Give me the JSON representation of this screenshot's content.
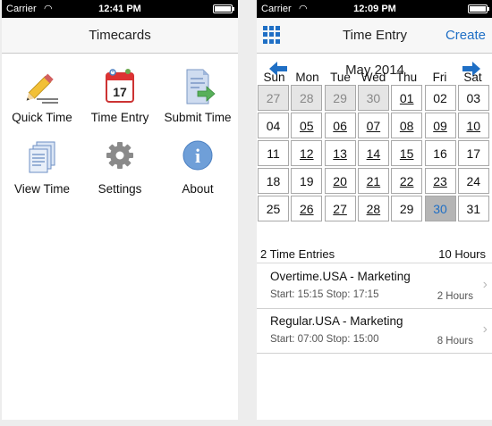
{
  "left": {
    "status": {
      "carrier": "Carrier",
      "time": "12:41 PM"
    },
    "title": "Timecards",
    "tiles": [
      {
        "label": "Quick Time",
        "icon": "pencil-icon"
      },
      {
        "label": "Time Entry",
        "icon": "calendar-icon",
        "badge": "17"
      },
      {
        "label": "Submit Time",
        "icon": "submit-document-icon"
      },
      {
        "label": "View Time",
        "icon": "document-stack-icon"
      },
      {
        "label": "Settings",
        "icon": "gear-icon"
      },
      {
        "label": "About",
        "icon": "info-icon",
        "glyph": "i"
      }
    ]
  },
  "right": {
    "status": {
      "carrier": "Carrier",
      "time": "12:09 PM"
    },
    "title": "Time Entry",
    "create_label": "Create",
    "month": "May 2014",
    "days_of_week": [
      "Sun",
      "Mon",
      "Tue",
      "Wed",
      "Thu",
      "Fri",
      "Sat"
    ],
    "weeks": [
      [
        "27",
        "28",
        "29",
        "30",
        "01",
        "02",
        "03"
      ],
      [
        "04",
        "05",
        "06",
        "07",
        "08",
        "09",
        "10"
      ],
      [
        "11",
        "12",
        "13",
        "14",
        "15",
        "16",
        "17"
      ],
      [
        "18",
        "19",
        "20",
        "21",
        "22",
        "23",
        "24"
      ],
      [
        "25",
        "26",
        "27",
        "28",
        "29",
        "30",
        "31"
      ]
    ],
    "entries_count": "2 Time Entries",
    "total_hours": "10 Hours",
    "entries": [
      {
        "name": "Overtime.USA - Marketing",
        "times": "Start: 15:15 Stop: 17:15",
        "duration": "2 Hours"
      },
      {
        "name": "Regular.USA - Marketing",
        "times": "Start: 07:00 Stop: 15:00",
        "duration": "8 Hours"
      }
    ],
    "colors": {
      "accent": "#1f6fc5",
      "selected_bg": "#b5b5b5",
      "prev_month_bg": "#e5e5e5"
    }
  }
}
